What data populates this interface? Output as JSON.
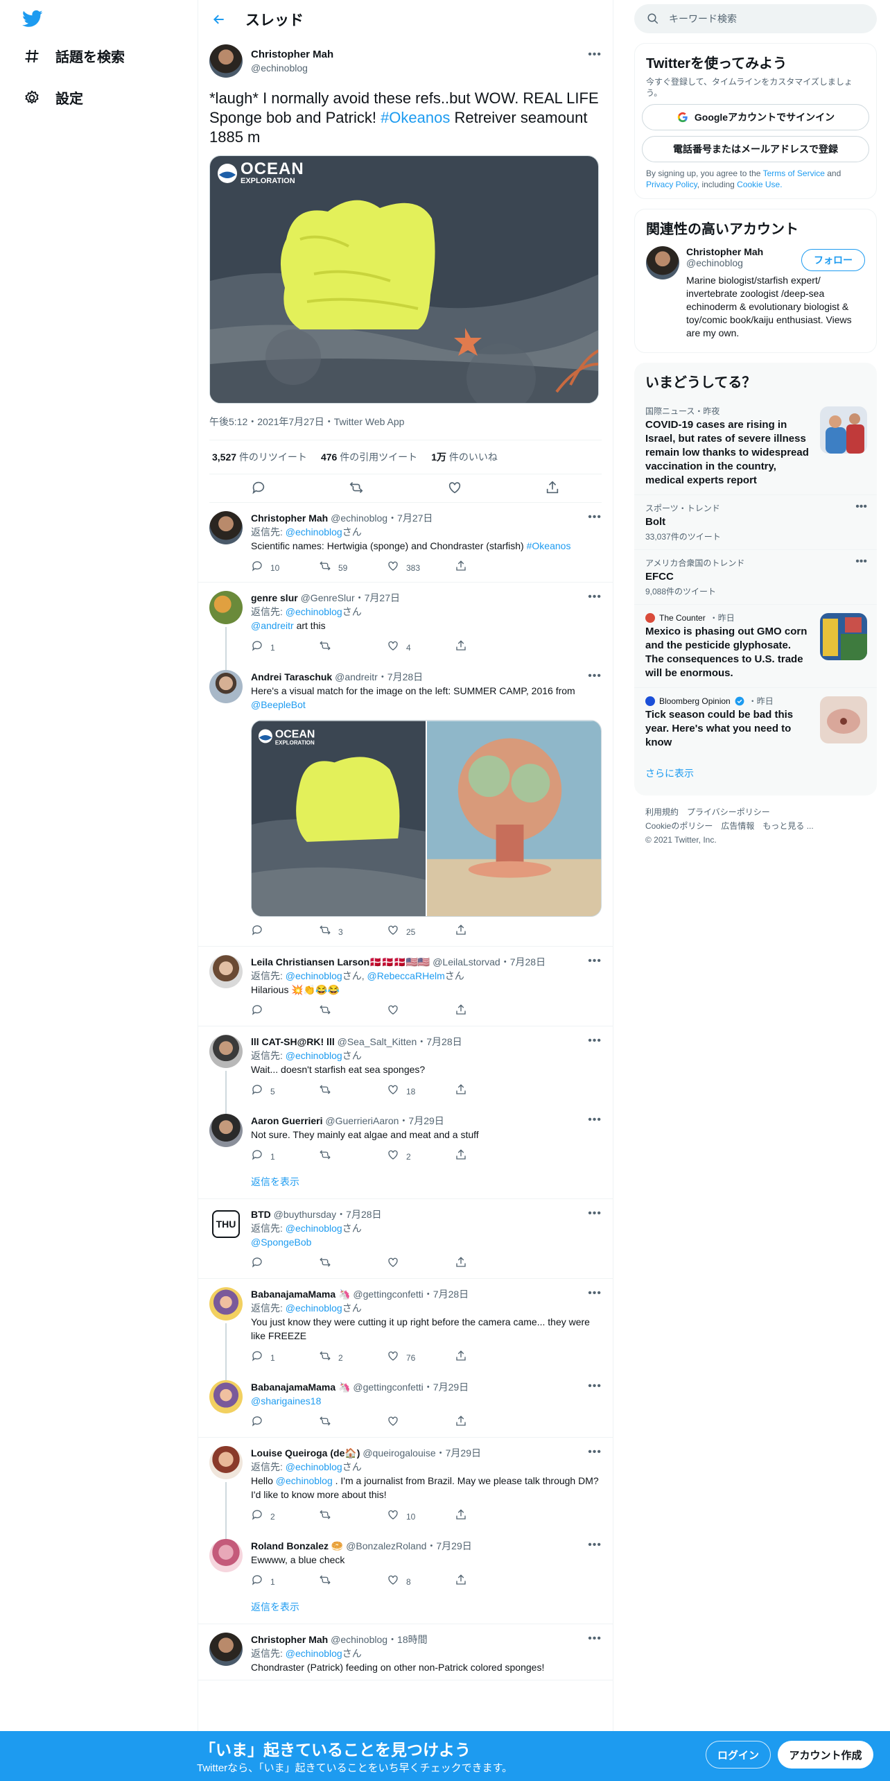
{
  "nav": {
    "explore": "話題を検索",
    "settings": "設定"
  },
  "header": {
    "title": "スレッド"
  },
  "main_tweet": {
    "name": "Christopher Mah",
    "handle": "@echinoblog",
    "text_before": "*laugh* I normally avoid these refs..but WOW. REAL LIFE Sponge bob and Patrick! ",
    "hashtag": "#Okeanos",
    "text_after": " Retreiver seamount  1885 m",
    "media_brand": "OCEAN",
    "media_brand_sub": "EXPLORATION",
    "meta": "午後5:12・2021年7月27日・Twitter Web App",
    "retweets": "3,527",
    "retweets_label": "件のリツイート",
    "quotes": "476",
    "quotes_label": "件の引用ツイート",
    "likes": "1万",
    "likes_label": "件のいいね"
  },
  "replying_label": "返信先: ",
  "san": "さん",
  "show_replies": "返信を表示",
  "replies": [
    {
      "name": "Christopher Mah",
      "handle": "@echinoblog",
      "date": "・7月27日",
      "reply_to": "@echinoblog",
      "text": "Scientific names: Hertwigia (sponge) and Chondraster (starfish) ",
      "tag": "#Okeanos",
      "replies": "10",
      "rts": "59",
      "likes": "383"
    },
    {
      "name": "genre slur",
      "handle": "@GenreSlur",
      "date": "・7月27日",
      "reply_to": "@echinoblog",
      "mention": "@andreitr",
      "text": " art this",
      "replies": "1",
      "rts": "",
      "likes": "4"
    },
    {
      "name": "Andrei Taraschuk",
      "handle": "@andreitr",
      "date": "・7月28日",
      "text": "Here's a visual match for the image on the left: SUMMER CAMP, 2016 from ",
      "mention": "@BeepleBot",
      "replies": "",
      "rts": "3",
      "likes": "25"
    },
    {
      "name": "Leila Christiansen Larson🇩🇰🇩🇰🇩🇰🇺🇸🇺🇸",
      "handle": "@LeilaLstorvad",
      "date": "・7月28日",
      "reply_to": "@echinoblog",
      "reply_to2": "@RebeccaRHelm",
      "text": "Hilarious 💥👏😂😂",
      "replies": "",
      "rts": "",
      "likes": ""
    },
    {
      "name": "lll CAT-SH@RK! lll",
      "handle": "@Sea_Salt_Kitten",
      "date": "・7月28日",
      "reply_to": "@echinoblog",
      "text": "Wait... doesn't starfish eat sea sponges?",
      "replies": "5",
      "rts": "",
      "likes": "18"
    },
    {
      "name": "Aaron Guerrieri",
      "handle": "@GuerrieriAaron",
      "date": "・7月29日",
      "text": "Not sure.  They mainly eat algae and meat and a stuff",
      "replies": "1",
      "rts": "",
      "likes": "2"
    },
    {
      "name": "BTD",
      "handle": "@buythursday",
      "date": "・7月28日",
      "reply_to": "@echinoblog",
      "mention": "@SpongeBob",
      "replies": "",
      "rts": "",
      "likes": ""
    },
    {
      "name": "BabanajamaMama 🦄",
      "handle": "@gettingconfetti",
      "date": "・7月28日",
      "reply_to": "@echinoblog",
      "text": "You just know they were cutting it up right before the camera came... they were like FREEZE",
      "replies": "1",
      "rts": "2",
      "likes": "76"
    },
    {
      "name": "BabanajamaMama 🦄",
      "handle": "@gettingconfetti",
      "date": "・7月29日",
      "mention": "@sharigaines18",
      "replies": "",
      "rts": "",
      "likes": ""
    },
    {
      "name": "Louise Queiroga (de🏠)",
      "handle": "@queirogalouise",
      "date": "・7月29日",
      "reply_to": "@echinoblog",
      "text_a": "Hello ",
      "mention": "@echinoblog",
      "text_b": " . I'm a journalist from Brazil. May we please talk through DM? I'd like to know more about this!",
      "replies": "2",
      "rts": "",
      "likes": "10"
    },
    {
      "name": "Roland Bonzalez 🥯",
      "handle": "@BonzalezRoland",
      "date": "・7月29日",
      "text": "Ewwww, a blue check",
      "replies": "1",
      "rts": "",
      "likes": "8"
    },
    {
      "name": "Christopher Mah",
      "handle": "@echinoblog",
      "date": "・18時間",
      "reply_to": "@echinoblog",
      "text": "Chondraster (Patrick) feeding on other non-Patrick colored sponges!"
    }
  ],
  "right": {
    "search_placeholder": "キーワード検索",
    "signup_title": "Twitterを使ってみよう",
    "signup_sub": "今すぐ登録して、タイムラインをカスタマイズしましょう。",
    "google_btn": "Googleアカウントでサインイン",
    "phone_btn": "電話番号またはメールアドレスで登録",
    "terms_a": "By signing up, you agree to the ",
    "terms_link": "Terms of Service",
    "terms_b": " and ",
    "privacy_link": "Privacy Policy",
    "terms_c": ", including ",
    "cookie_link": "Cookie Use.",
    "related_title": "関連性の高いアカウント",
    "related_name": "Christopher Mah",
    "related_handle": "@echinoblog",
    "follow_btn": "フォロー",
    "related_bio": "Marine biologist/starfish expert/ invertebrate zoologist /deep-sea echinoderm & evolutionary biologist & toy/comic book/kaiju enthusiast. Views are my own.",
    "trends_title": "いまどうしてる？",
    "trends": [
      {
        "cat": "国際ニュース・昨夜",
        "text": "COVID-19 cases are rising in Israel, but rates of severe illness remain low thanks to widespread vaccination in the country, medical experts report"
      },
      {
        "cat": "スポーツ・トレンド",
        "text": "Bolt",
        "count": "33,037件のツイート"
      },
      {
        "cat": "アメリカ合衆国のトレンド",
        "text": "EFCC",
        "count": "9,088件のツイート"
      },
      {
        "source": "The Counter",
        "when": "・昨日",
        "text": "Mexico is phasing out GMO corn and the pesticide glyphosate. The consequences to U.S. trade will be enormous."
      },
      {
        "source": "Bloomberg Opinion",
        "when": "・昨日",
        "text": "Tick season could be bad this year. Here's what you need to know"
      }
    ],
    "show_more": "さらに表示",
    "footer1": "利用規約　プライバシーポリシー",
    "footer2": "Cookieのポリシー　広告情報　もっと見る ...",
    "footer3": "© 2021 Twitter, Inc."
  },
  "banner": {
    "title": "「いま」起きていることを見つけよう",
    "sub": "Twitterなら、「いま」起きていることをいち早くチェックできます。",
    "login": "ログイン",
    "signup": "アカウント作成"
  }
}
